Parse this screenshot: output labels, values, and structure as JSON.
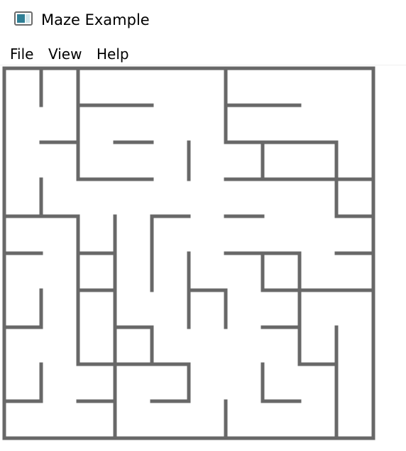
{
  "window": {
    "title": "Maze Example",
    "icon": "app-window-icon"
  },
  "menu": {
    "items": [
      "File",
      "View",
      "Help"
    ]
  },
  "maze": {
    "rows": 10,
    "cols": 10,
    "wall_color": "#686868",
    "background": "#ffffff",
    "borders": [
      "top",
      "left",
      "right",
      "bottom"
    ],
    "horizontal_walls": [
      [
        1,
        2,
        3
      ],
      [
        1,
        6,
        7
      ],
      [
        2,
        1,
        1
      ],
      [
        2,
        3,
        3
      ],
      [
        2,
        6,
        8
      ],
      [
        3,
        2,
        3
      ],
      [
        3,
        6,
        9
      ],
      [
        4,
        0,
        1
      ],
      [
        4,
        4,
        4
      ],
      [
        4,
        6,
        6
      ],
      [
        4,
        9,
        9
      ],
      [
        5,
        0,
        0
      ],
      [
        5,
        2,
        2
      ],
      [
        5,
        6,
        7
      ],
      [
        5,
        9,
        9
      ],
      [
        6,
        2,
        2
      ],
      [
        6,
        5,
        5
      ],
      [
        6,
        7,
        9
      ],
      [
        7,
        0,
        0
      ],
      [
        7,
        3,
        3
      ],
      [
        7,
        7,
        7
      ],
      [
        8,
        2,
        4
      ],
      [
        8,
        8,
        8
      ],
      [
        9,
        0,
        0
      ],
      [
        9,
        2,
        2
      ],
      [
        9,
        4,
        4
      ],
      [
        9,
        7,
        7
      ]
    ],
    "vertical_walls": [
      [
        1,
        0,
        0
      ],
      [
        2,
        0,
        2
      ],
      [
        3,
        7,
        8
      ],
      [
        5,
        2,
        2
      ],
      [
        6,
        1,
        1
      ],
      [
        6,
        0,
        0
      ],
      [
        7,
        2,
        2
      ],
      [
        9,
        2,
        3
      ],
      [
        1,
        3,
        3
      ],
      [
        2,
        4,
        5
      ],
      [
        3,
        4,
        6
      ],
      [
        4,
        4,
        5
      ],
      [
        5,
        5,
        6
      ],
      [
        6,
        6,
        6
      ],
      [
        7,
        5,
        5
      ],
      [
        8,
        5,
        7
      ],
      [
        1,
        6,
        6
      ],
      [
        2,
        6,
        6
      ],
      [
        9,
        7,
        8
      ],
      [
        3,
        9,
        9
      ],
      [
        6,
        9,
        9
      ],
      [
        5,
        8,
        8
      ],
      [
        4,
        7,
        7
      ],
      [
        8,
        7,
        7
      ],
      [
        1,
        8,
        8
      ],
      [
        2,
        6,
        7
      ],
      [
        7,
        8,
        8
      ],
      [
        9,
        9,
        9
      ]
    ]
  }
}
